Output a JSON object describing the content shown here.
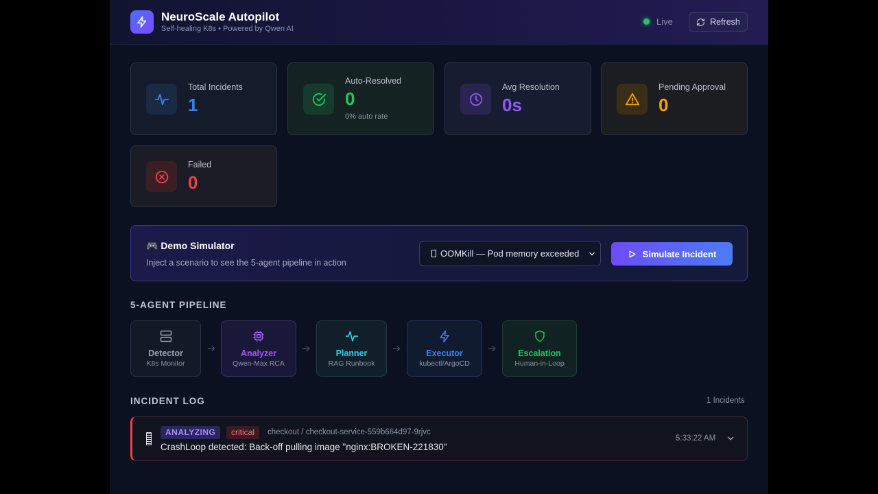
{
  "header": {
    "title": "NeuroScale Autopilot",
    "subtitle": "Self-healing K8s • Powered by Qwen AI",
    "live_label": "Live",
    "refresh_label": "Refresh"
  },
  "stats": {
    "total": {
      "label": "Total Incidents",
      "value": "1",
      "color": "#3b82f6"
    },
    "auto_resolved": {
      "label": "Auto-Resolved",
      "value": "0",
      "sub": "0% auto rate",
      "color": "#22c55e"
    },
    "avg_resolution": {
      "label": "Avg Resolution",
      "value": "0s",
      "color": "#8b5cf6"
    },
    "pending": {
      "label": "Pending Approval",
      "value": "0",
      "color": "#f59e0b"
    },
    "failed": {
      "label": "Failed",
      "value": "0",
      "color": "#ef4444"
    }
  },
  "simulator": {
    "title": "🎮 Demo Simulator",
    "description": "Inject a scenario to see the 5-agent pipeline in action",
    "selected_scenario": "OOMKill — Pod memory exceeded",
    "button_label": "Simulate Incident"
  },
  "pipeline": {
    "title": "5-AGENT PIPELINE",
    "stages": [
      {
        "name": "Detector",
        "sub": "K8s Monitor",
        "icon": "server-icon",
        "color": "#9ca3af"
      },
      {
        "name": "Analyzer",
        "sub": "Qwen-Max RCA",
        "icon": "cpu-icon",
        "color": "#a855f7"
      },
      {
        "name": "Planner",
        "sub": "RAG Runbook",
        "icon": "activity-icon",
        "color": "#22d3ee"
      },
      {
        "name": "Executor",
        "sub": "kubectl/ArgoCD",
        "icon": "zap-icon",
        "color": "#3b82f6"
      },
      {
        "name": "Escalation",
        "sub": "Human-in-Loop",
        "icon": "shield-icon",
        "color": "#22c55e"
      }
    ]
  },
  "incident_log": {
    "title": "INCIDENT LOG",
    "count": "1 Incidents",
    "incidents": [
      {
        "state": "ANALYZING",
        "severity": "critical",
        "path": "checkout / checkout-service-559b664d97-9rjvc",
        "message": "CrashLoop detected: Back-off pulling image \"nginx:BROKEN-221830\"",
        "time": "5:33:22 AM"
      }
    ]
  }
}
